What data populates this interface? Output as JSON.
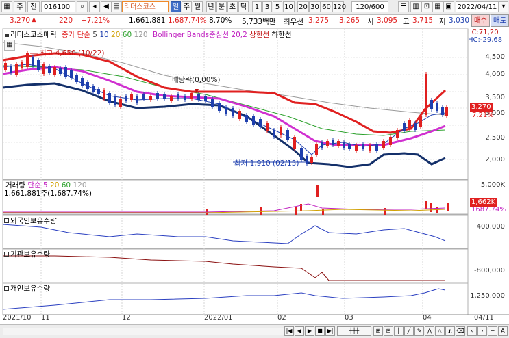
{
  "toolbar": {
    "market": "주",
    "range": "전",
    "code": "016100",
    "name": "리더스코스",
    "periods": [
      "일",
      "주",
      "월",
      "년",
      "분",
      "초",
      "틱"
    ],
    "intervals": [
      "1",
      "3",
      "5",
      "10",
      "20",
      "30",
      "60",
      "120"
    ],
    "count": "120/600",
    "date": "2022/04/11"
  },
  "info": {
    "price": "3,270",
    "change": "220",
    "pct": "+7.21%",
    "volume": "1,661,881",
    "vol_pct": "1,687.74%",
    "turnover": "8.70%",
    "amount": "5,733백만",
    "best_ask_label": "최우선",
    "best_ask": "3,275",
    "best_bid": "3,265",
    "open_label": "시",
    "open": "3,095",
    "high_label": "고",
    "high": "3,715",
    "low_label": "저",
    "low": "3,030",
    "buy": "매수",
    "sell": "매도"
  },
  "legend": {
    "name": "리더스코스메틱",
    "ma_label": "종가 단순",
    "ma5": "5",
    "ma10": "10",
    "ma20": "20",
    "ma60": "60",
    "ma120": "120",
    "bb": "Bollinger Bands중심선 20,2",
    "bb_up": "상한선",
    "bb_low": "하한선",
    "lc": "LC:71,20",
    "hc": "HC:-29,68",
    "max_note": "최고 4,650 (10/22)",
    "min_note": "최저 1,910 (02/15)",
    "div_note": "배당락(0,00%)",
    "price_tag": "3,270",
    "pct_tag": "7.21%"
  },
  "volume_panel": {
    "title": "거래량",
    "ma_label": "단순",
    "ma5": "5",
    "ma20": "20",
    "ma60": "60",
    "ma120": "120",
    "value": "1,661,881주(1,687.74%)",
    "tag": "1,662K",
    "tag2": "1687.74%"
  },
  "panels": {
    "foreign": "외국인보유수량",
    "inst": "기관보유수량",
    "indiv": "개인보유수량"
  },
  "y_price": [
    "4,500",
    "4,000",
    "3,500",
    "3,000",
    "2,500",
    "2,000"
  ],
  "y_volume": [
    "5,000K"
  ],
  "y_foreign": [
    "400,000"
  ],
  "y_inst": [
    "-800,000"
  ],
  "y_indiv": [
    "1,250,000"
  ],
  "x_labels": [
    "2021/10",
    "11",
    "12",
    "2022/01",
    "02",
    "03",
    "04",
    "04/11"
  ],
  "colors": {
    "up": "#e02020",
    "down": "#1e3fae",
    "accent": "#3f6ec6"
  }
}
